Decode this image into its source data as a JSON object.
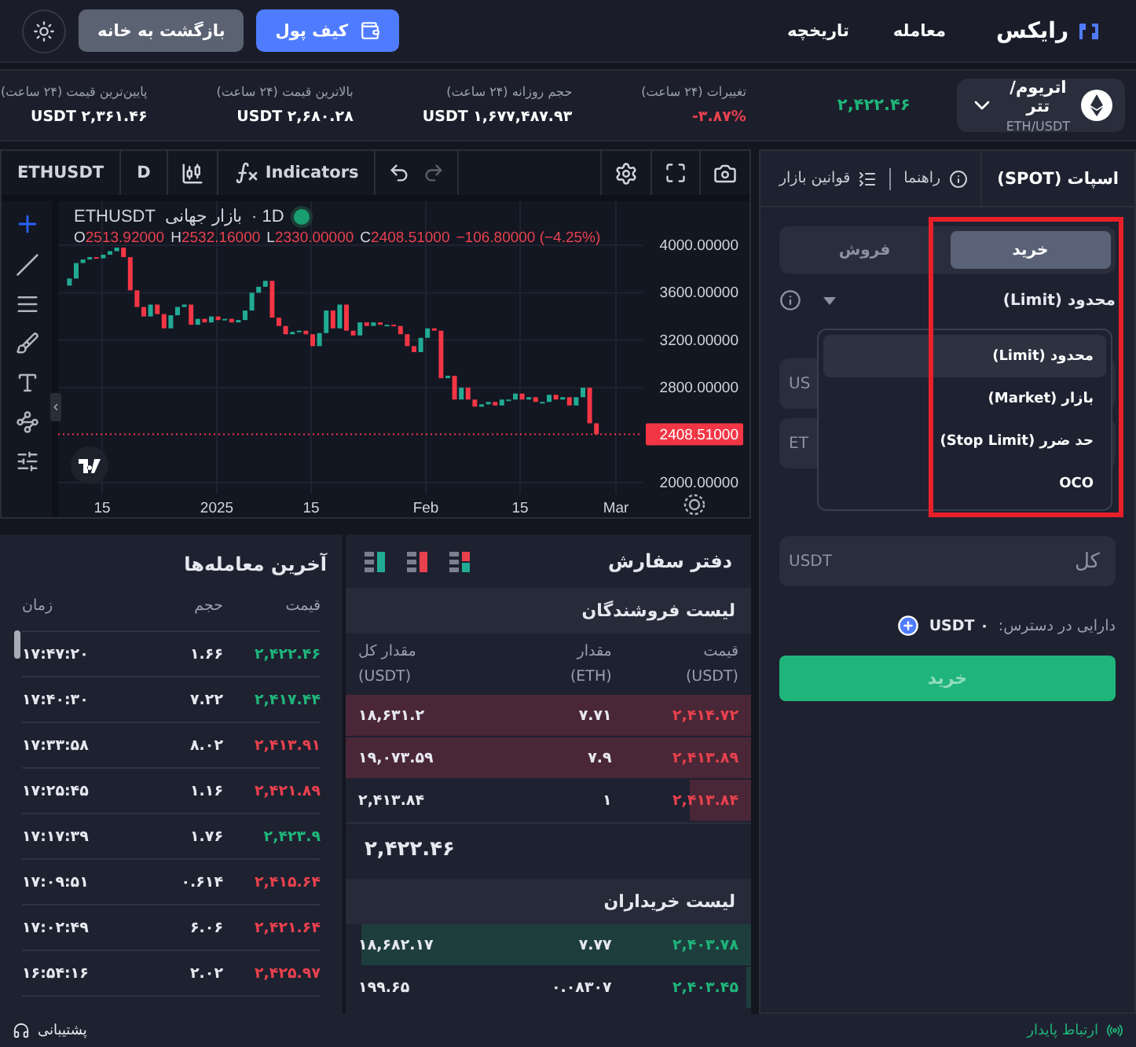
{
  "nav": {
    "logo": "رایکس",
    "links": [
      "معامله",
      "تاریخچه"
    ],
    "wallet_button": "کیف پول",
    "home_button": "بازگشت به خانه"
  },
  "ticker": {
    "pair": "اتریوم/تتر",
    "symbol": "ETH/USDT",
    "price": "۲,۴۲۲.۴۶",
    "stats": [
      {
        "label": "تغییرات (۲۴ ساعت)",
        "value": "-۳.۸۷%",
        "kind": "change"
      },
      {
        "label": "حجم روزانه (۲۴ ساعت)",
        "value": "USDT ۱,۶۷۷,۴۸۷.۹۳",
        "kind": "plain"
      },
      {
        "label": "بالاترین قیمت (۲۴ ساعت)",
        "value": "USDT ۲,۶۸۰.۲۸",
        "kind": "plain"
      },
      {
        "label": "پایین‌ترین قیمت (۲۴ ساعت)",
        "value": "USDT ۲,۳۶۱.۴۶",
        "kind": "plain"
      }
    ]
  },
  "chart": {
    "toolbar": {
      "symbol": "ETHUSDT",
      "interval": "D",
      "indicators": "Indicators"
    },
    "legend": {
      "symbol": "ETHUSDT",
      "market": "بازار جهانی",
      "interval": "· 1D",
      "ohlc": [
        {
          "key": "C",
          "value": "2408.51000"
        },
        {
          "key": "L",
          "value": "2330.00000"
        },
        {
          "key": "H",
          "value": "2532.16000"
        },
        {
          "key": "O",
          "value": "2513.92000"
        }
      ],
      "change": "−106.80000 (−4.25%)"
    },
    "price_tag": "2408.51000",
    "y_labels": [
      "4000.00000",
      "3600.00000",
      "3200.00000",
      "2800.00000",
      "2000.00000"
    ],
    "x_labels": [
      "Mar",
      "15",
      "Feb",
      "15",
      "2025",
      "15"
    ]
  },
  "trades": {
    "title": "آخرین معامله‌ها",
    "columns": [
      "قیمت",
      "حجم",
      "زمان"
    ],
    "rows": [
      {
        "price": "۲,۴۲۲.۴۶",
        "volume": "۱.۶۶",
        "time": "۱۷:۴۷:۲۰",
        "color": "#1fb57a"
      },
      {
        "price": "۲,۴۱۷.۴۴",
        "volume": "۷.۲۲",
        "time": "۱۷:۴۰:۳۰",
        "color": "#1fb57a"
      },
      {
        "price": "۲,۴۱۳.۹۱",
        "volume": "۸.۰۲",
        "time": "۱۷:۳۳:۵۸",
        "color": "#e8414e"
      },
      {
        "price": "۲,۴۲۱.۸۹",
        "volume": "۱.۱۶",
        "time": "۱۷:۲۵:۴۵",
        "color": "#e8414e"
      },
      {
        "price": "۲,۴۲۳.۹",
        "volume": "۱.۷۶",
        "time": "۱۷:۱۷:۳۹",
        "color": "#1fb57a"
      },
      {
        "price": "۲,۴۱۵.۶۴",
        "volume": "۰.۶۱۴",
        "time": "۱۷:۰۹:۵۱",
        "color": "#e8414e"
      },
      {
        "price": "۲,۴۲۱.۶۴",
        "volume": "۶.۰۶",
        "time": "۱۷:۰۲:۴۹",
        "color": "#e8414e"
      },
      {
        "price": "۲,۴۲۵.۹۷",
        "volume": "۲.۰۲",
        "time": "۱۶:۵۴:۱۶",
        "color": "#e8414e"
      }
    ]
  },
  "order_book": {
    "title": "دفتر سفارش",
    "asks_title": "لیست فروشندگان",
    "bids_title": "لیست خریداران",
    "columns": [
      {
        "label": "قیمت",
        "unit": "(USDT)"
      },
      {
        "label": "مقدار",
        "unit": "(ETH)"
      },
      {
        "label": "مقدار کل",
        "unit": "(USDT)"
      }
    ],
    "asks": [
      {
        "price": "۲,۴۱۴.۷۲",
        "amount": "۷.۷۱",
        "total": "۱۸,۶۳۱.۲",
        "level": 1
      },
      {
        "price": "۲,۴۱۳.۸۹",
        "amount": "۷.۹",
        "total": "۱۹,۰۷۳.۵۹",
        "level": 1
      },
      {
        "price": "۲,۴۱۳.۸۴",
        "amount": "۱",
        "total": "۲,۴۱۳.۸۴",
        "level": 0.15
      }
    ],
    "mid_price": "۲,۴۲۲.۴۶",
    "bids": [
      {
        "price": "۲,۴۰۳.۷۸",
        "amount": "۷.۷۷",
        "total": "۱۸,۶۸۲.۱۷",
        "level": 0.96
      },
      {
        "price": "۲,۴۰۳.۴۵",
        "amount": "۰.۰۸۳۰۷",
        "total": "۱۹۹.۶۵",
        "level": 0.01
      }
    ]
  },
  "order_form": {
    "tab": "اسپات (SPOT)",
    "links": [
      "راهنما",
      "قوانین بازار"
    ],
    "sides": [
      {
        "label": "خرید",
        "selected": true
      },
      {
        "label": "فروش",
        "selected": false
      }
    ],
    "order_type": "محدود (Limit)",
    "dropdown": [
      {
        "label": "محدود (Limit)",
        "selected": true
      },
      {
        "label": "بازار (Market)",
        "selected": false
      },
      {
        "label": "حد ضرر (Stop Limit)",
        "selected": false
      },
      {
        "label": "OCO",
        "selected": false
      }
    ],
    "covered_fields": [
      "US",
      "ET"
    ],
    "total": {
      "label": "کل",
      "unit": "USDT"
    },
    "available_label": "دارایی در دسترس:",
    "available_value": "USDT ۰",
    "submit": "خرید"
  },
  "footer": {
    "support": "پشتیبانی",
    "connection": "ارتباط پایدار"
  }
}
